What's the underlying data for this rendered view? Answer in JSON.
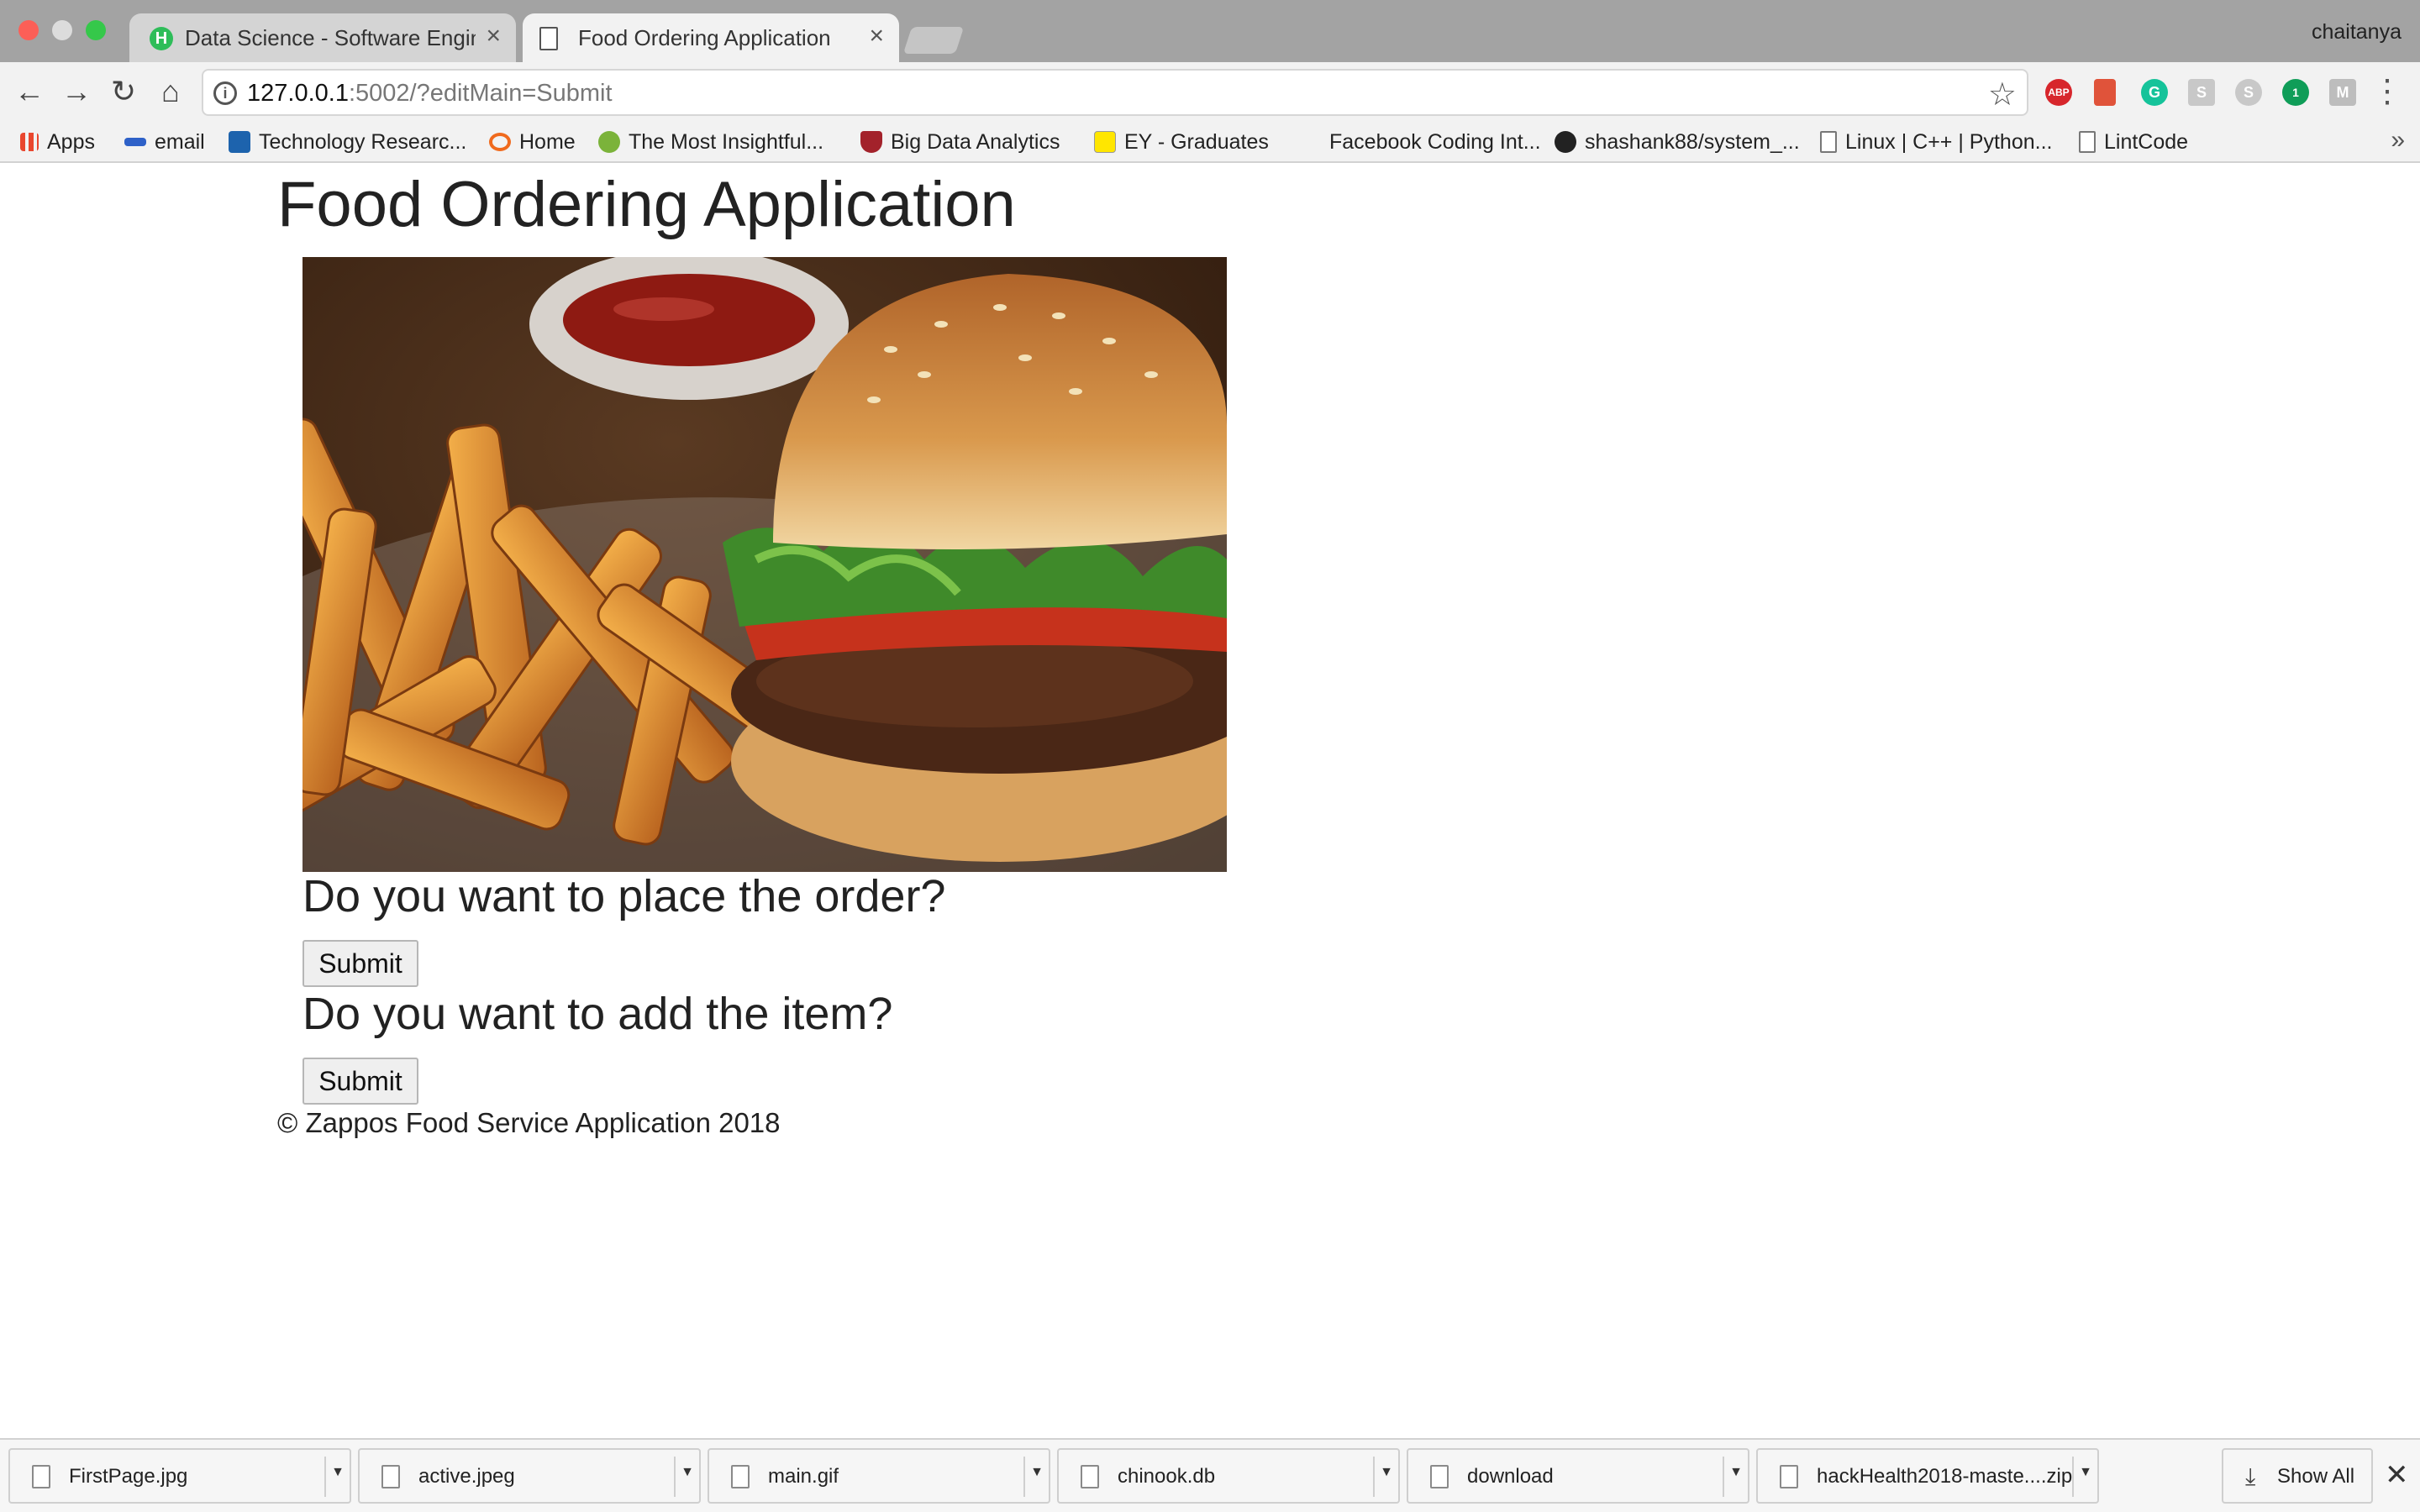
{
  "browser": {
    "profile": "chaitanya",
    "tabs": [
      {
        "title": "Data Science - Software Engin",
        "icon": "hackerrank-h-icon",
        "active": false
      },
      {
        "title": "Food Ordering Application",
        "icon": "document-icon",
        "active": true
      }
    ],
    "tab_close_glyph": "×",
    "url_host": "127.0.0.1",
    "url_rest": ":5002/?editMain=Submit",
    "info_glyph": "i",
    "extensions": [
      {
        "name": "adblock-plus-icon",
        "label": "ABP",
        "color": "#d7262c"
      },
      {
        "name": "bookmark-extension-icon",
        "label": "",
        "color": "#e0533a"
      },
      {
        "name": "grammarly-icon",
        "label": "G",
        "color": "#15c39a"
      },
      {
        "name": "s-extension-icon",
        "label": "S",
        "color": "#c8c8c8"
      },
      {
        "name": "skype-icon",
        "label": "S",
        "color": "#c8c8c8"
      },
      {
        "name": "hangouts-icon",
        "label": "1",
        "color": "#0f9d58"
      },
      {
        "name": "m-extension-icon",
        "label": "M",
        "color": "#bdbdbd"
      }
    ]
  },
  "bookmarks": [
    {
      "label": "Apps",
      "icon": "apps-grid-icon",
      "color": "#e9472f"
    },
    {
      "label": "email",
      "icon": "ms4-icon",
      "color": "#2e61c8"
    },
    {
      "label": "Technology Researc...",
      "icon": "gartner-icon",
      "color": "#1d63ad"
    },
    {
      "label": "Home",
      "icon": "home-arc-icon",
      "color": "#f06a1d"
    },
    {
      "label": "The Most Insightful...",
      "icon": "tree-icon",
      "color": "#7bb33a"
    },
    {
      "label": "Big Data Analytics",
      "icon": "shield-icon",
      "color": "#a3222b"
    },
    {
      "label": "EY - Graduates",
      "icon": "ey-icon",
      "color": "#ffe600"
    },
    {
      "label": "Facebook Coding Int...",
      "icon": "blank-icon",
      "color": "#f2f2f2"
    },
    {
      "label": "shashank88/system_...",
      "icon": "github-icon",
      "color": "#222222"
    },
    {
      "label": "Linux | C++ | Python...",
      "icon": "document-icon",
      "color": "#ffffff"
    },
    {
      "label": "LintCode",
      "icon": "document-icon",
      "color": "#ffffff"
    }
  ],
  "bookmarks_more": "»",
  "page": {
    "title": "Food Ordering Application",
    "q1": "Do you want to place the order?",
    "q1_button": "Submit",
    "q2": "Do you want to add the item?",
    "q2_button": "Submit",
    "footer": "© Zappos Food Service Application 2018"
  },
  "downloads": [
    {
      "name": "FirstPage.jpg",
      "icon": "image-file-icon"
    },
    {
      "name": "active.jpeg",
      "icon": "image-file-icon"
    },
    {
      "name": "main.gif",
      "icon": "image-file-icon"
    },
    {
      "name": "chinook.db",
      "icon": "file-icon"
    },
    {
      "name": "download",
      "icon": "file-icon"
    },
    {
      "name": "hackHealth2018-maste....zip",
      "icon": "zip-file-icon"
    }
  ],
  "show_all": "Show All"
}
